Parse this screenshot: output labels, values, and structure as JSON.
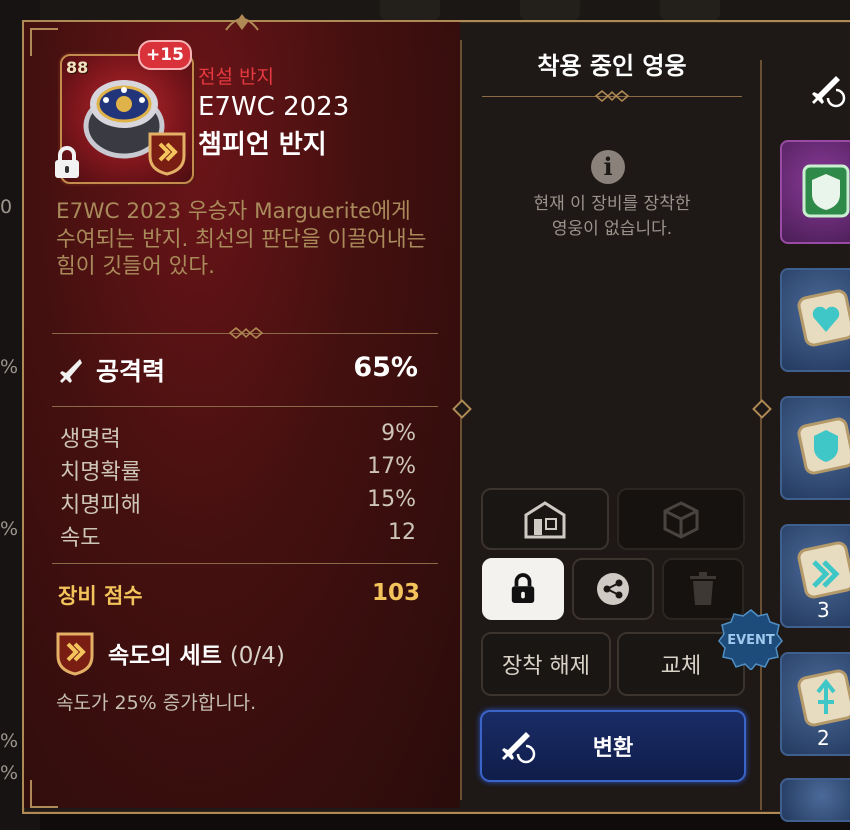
{
  "item": {
    "level": "88",
    "enhance": "+15",
    "rarity": "전설 반지",
    "name_line1": "E7WC 2023",
    "name_line2": "챔피언 반지",
    "description": "E7WC 2023 우승자 Marguerite에게 수여되는 반지. 최선의 판단을 이끌어내는 힘이 깃들어 있다.",
    "main_stat": {
      "label": "공격력",
      "value": "65%"
    },
    "sub_stats": [
      {
        "label": "생명력",
        "value": "9%"
      },
      {
        "label": "치명확률",
        "value": "17%"
      },
      {
        "label": "치명피해",
        "value": "15%"
      },
      {
        "label": "속도",
        "value": "12"
      }
    ],
    "score": {
      "label": "장비 점수",
      "value": "103"
    },
    "set": {
      "name": "속도의 세트",
      "count": "(0/4)",
      "desc": "속도가 25% 증가합니다."
    }
  },
  "hero_panel": {
    "title": "착용 중인 영웅",
    "empty_line1": "현재 이 장비를 장착한",
    "empty_line2": "영웅이 없습니다."
  },
  "actions": {
    "unequip": "장착 해제",
    "replace": "교체",
    "convert": "변환",
    "event_badge": "EVENT"
  },
  "inventory": {
    "counts": [
      "3",
      "2"
    ]
  },
  "background": {
    "left_fragments": [
      "0",
      "%",
      "%",
      "%",
      "%"
    ]
  },
  "colors": {
    "rarity_red": "#e53a3f",
    "score_gold": "#f3c45b",
    "convert_blue": "#3b64c9",
    "frame_gold": "#b08a55"
  },
  "icons": {
    "lock": "lock-icon",
    "set": "speed-set-icon",
    "attack": "sword-icon",
    "info": "info-icon",
    "share": "share-icon",
    "trash": "trash-icon",
    "storage": "storage-icon",
    "dice": "dice-icon",
    "convert": "convert-icon"
  }
}
